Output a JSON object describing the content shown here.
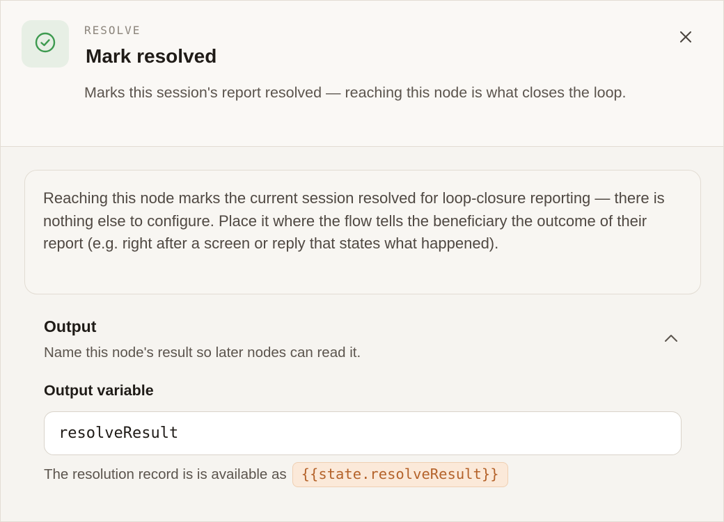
{
  "header": {
    "eyebrow": "RESOLVE",
    "title": "Mark resolved",
    "description": "Marks this session's report resolved — reaching this node is what closes the loop.",
    "icon": "check-circle-icon",
    "close_icon": "close-icon"
  },
  "info": {
    "text": "Reaching this node marks the current session resolved for loop-closure reporting — there is nothing else to configure. Place it where the flow tells the beneficiary the outcome of their report (e.g. right after a screen or reply that states what happened)."
  },
  "output": {
    "title": "Output",
    "subtitle": "Name this node's result so later nodes can read it.",
    "collapse_icon": "chevron-up-icon",
    "field_label": "Output variable",
    "field_value": "resolveResult",
    "hint_prefix": "The resolution record is is available as",
    "hint_token": "{{state.resolveResult}}"
  },
  "colors": {
    "accent_green": "#3d9a4f",
    "token_text": "#b4622a",
    "token_bg": "#fbe9d9"
  }
}
